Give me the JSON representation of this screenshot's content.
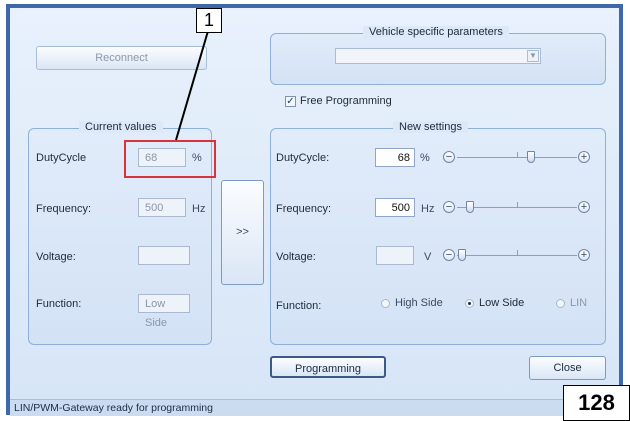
{
  "callout_number": "1",
  "page_number": "128",
  "status_bar": "LIN/PWM-Gateway ready for programming",
  "reconnect_label": "Reconnect",
  "vehicle_params": {
    "legend": "Vehicle specific parameters",
    "selected": ""
  },
  "free_programming": {
    "label": "Free Programming",
    "checked": true
  },
  "current_values": {
    "legend": "Current values",
    "duty_label": "DutyCycle",
    "duty_value": "68",
    "duty_unit": "%",
    "freq_label": "Frequency:",
    "freq_value": "500",
    "freq_unit": "Hz",
    "volt_label": "Voltage:",
    "volt_value": "",
    "func_label": "Function:",
    "func_value": "Low Side"
  },
  "transfer_label": ">>",
  "new_settings": {
    "legend": "New settings",
    "duty_label": "DutyCycle:",
    "duty_value": "68",
    "duty_unit": "%",
    "duty_slider_fraction": 0.68,
    "freq_label": "Frequency:",
    "freq_value": "500",
    "freq_unit": "Hz",
    "freq_slider_fraction": 0.1,
    "volt_label": "Voltage:",
    "volt_value": "",
    "volt_unit": "V",
    "volt_slider_fraction": 0.0,
    "func_label": "Function:",
    "options": [
      "High Side",
      "Low Side",
      "LIN"
    ],
    "selected_option": "Low Side"
  },
  "programming_label": "Programming",
  "close_label": "Close"
}
